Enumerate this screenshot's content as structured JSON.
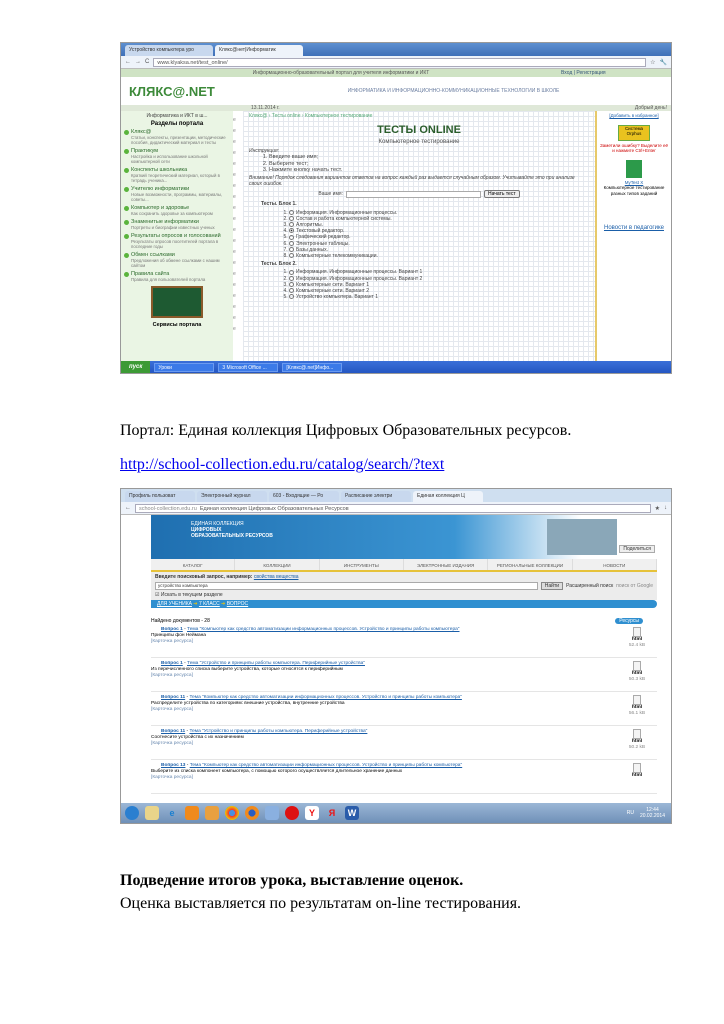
{
  "shot1": {
    "tabs": [
      "Устройство компьютера уро",
      "Клякс@нет|Информатик"
    ],
    "url": "www.klyaksa.net/test_online/",
    "top_banner": "Информационно-образовательный портал для учителя информатики и ИКТ",
    "login": "Вход | Регистрация",
    "logo": "КЛЯКС@.NET",
    "subtitle": "ИНФОРМАТИКА И ИНФОРМАЦИОННО-КОММУНИКАЦИОННЫЕ ТЕХНОЛОГИИ В ШКОЛЕ",
    "date": "13.11.2014 г.",
    "greeting": "Добрый день!",
    "side_header": "Информатика и ИКТ в ш...",
    "sections_title": "Разделы портала",
    "sections": [
      {
        "title": "Клякс@",
        "desc": "Статьи, конспекты, презентации, методические пособия, дидактический материал и тесты"
      },
      {
        "title": "Практикум",
        "desc": "Настройка и использование школьной компьютерной сети"
      },
      {
        "title": "Конспекты школьника",
        "desc": "Краткий теоретический материал, который в тетрадь ученика..."
      },
      {
        "title": "Учителю информатики",
        "desc": "Новые возможности, программы, материалы, советы..."
      },
      {
        "title": "Компьютер и здоровье",
        "desc": "Как сохранить здоровье за компьютером"
      },
      {
        "title": "Знаменитые информатики",
        "desc": "Портреты и биографии известных ученых"
      },
      {
        "title": "Результаты опросов и голосований",
        "desc": "Результаты опросов посетителей портала в последние годы"
      },
      {
        "title": "Обмен ссылками",
        "desc": "Предложения об обмене ссылками с нашим сайтом"
      },
      {
        "title": "Правила сайта",
        "desc": "Правила для пользователей портала"
      }
    ],
    "services": "Сервисы портала",
    "breadcrumb": "Клякс@ › Тесты online › Компьютерное тестирование",
    "heading": "ТЕСТЫ ONLINE",
    "subheading": "Компьютерное тестирование",
    "instr_title": "Инструкция:",
    "instructions": [
      "Введите ваше имя;",
      "Выберите тест;",
      "Нажмите кнопку начать тест."
    ],
    "warning": "Внимание! Порядок следования вариантов ответов на вопрос каждый раз выдается случайным образом. Учитывайте это при анализе своих ошибок.",
    "name_label": "Ваше имя:",
    "start_button": "Начать тест",
    "block1_title": "Тесты. Блок 1.",
    "block1": [
      "Информация. Информационные процессы.",
      "Состав и работа компьютерной системы.",
      "Алгоритмы.",
      "Текстовый редактор.",
      "Графический редактор.",
      "Электронные таблицы.",
      "Базы данных.",
      "Компьютерные телекоммуникации."
    ],
    "block2_title": "Тесты. Блок 2.",
    "block2": [
      "Информация. Информационные процессы. Вариант 1",
      "Информация. Информационные процессы. Вариант 2",
      "Компьютерные сети. Вариант 1",
      "Компьютерные сети. Вариант 2",
      "Устройство компьютера. Вариант 1"
    ],
    "right_add": "[Добавить в избранное]",
    "right_orphus": "Система Orphus",
    "right_text": "Заметили ошибку? Выделите её и нажмите Ctrl+Enter",
    "right_mytest": "MyTest X",
    "right_mytest_desc": "Компьютерное тестирование разных типов заданий",
    "right_link": "Новости в педагогике",
    "taskbar": {
      "start": "пуск",
      "tasks": [
        "Уроки",
        "3 Microsoft Office ...",
        "[Клякс@.net]Инфо..."
      ]
    }
  },
  "caption1": "Портал: Единая коллекция Цифровых Образовательных ресурсов.",
  "link": "http://school-collection.edu.ru/catalog/search/?text",
  "shot2": {
    "tabs": [
      "Профиль пользоват",
      "Электронный журнал",
      "603 - Входящие — Ро",
      "Расписание электри",
      "Единая коллекция Ц"
    ],
    "url": "school-collection.edu.ru",
    "page_title": "Единая коллекция Цифровых Образовательных Ресурсов",
    "logo_lines": [
      "ЕДИНАЯ КОЛЛЕКЦИЯ",
      "ЦИФРОВЫХ",
      "ОБРАЗОВАТЕЛЬНЫХ РЕСУРСОВ"
    ],
    "share": "Поделиться",
    "nav": [
      "КАТАЛОГ",
      "КОЛЛЕКЦИИ",
      "ИНСТРУМЕНТЫ",
      "ЭЛЕКТРОННЫЕ ИЗДАНИЯ",
      "РЕГИОНАЛЬНЫЕ КОЛЛЕКЦИИ",
      "НОВОСТИ"
    ],
    "search_label": "Введите поисковый запрос, например:",
    "search_example": "свойства вещества",
    "search_value": "устройство компьютера",
    "search_button": "Найти",
    "advanced": "Расширенный поиск",
    "google": "поиск от Google",
    "checkbox": "Искать в текущем разделе",
    "crumbs": [
      "ДЛЯ УЧЕНИКА",
      "7 КЛАСС",
      "ВОПРОС"
    ],
    "found": "Найдено документов - 28",
    "sort": "Ресурсы",
    "results": [
      {
        "q": "Вопрос 1",
        "topic": "Тема \"Компьютер как средство автоматизации информационных процессов. Устройство и принципы работы компьютера\"",
        "desc": "Принципы фон Неймана",
        "card": "[Карточка ресурса]",
        "type": "html",
        "size": "52.4 kB"
      },
      {
        "q": "Вопрос 1",
        "topic": "Тема \"Устройство и принципы работы компьютера. Периферийные устройства\"",
        "desc": "Из перечисленного списка выберите устройства, которые относятся к периферийным",
        "card": "[Карточка ресурса]",
        "type": "html",
        "size": "50.3 kB"
      },
      {
        "q": "Вопрос 11",
        "topic": "Тема \"Компьютер как средство автоматизации информационных процессов. Устройство и принципы работы компьютера\"",
        "desc": "Распределите устройства по категориям: внешние устройства, внутренние устройства",
        "card": "[Карточка ресурса]",
        "type": "html",
        "size": "56.1 kB"
      },
      {
        "q": "Вопрос 11",
        "topic": "Тема \"Устройство и принципы работы компьютера. Периферийные устройства\"",
        "desc": "Соотнесите устройства с их назначением",
        "card": "[Карточка ресурса]",
        "type": "html",
        "size": "50.2 kB"
      },
      {
        "q": "Вопрос 13",
        "topic": "Тема \"Компьютер как средство автоматизации информационных процессов. Устройство и принципы работы компьютера\"",
        "desc": "Выберите из списка компонент компьютера, с помощью которого осуществляется длительное хранение данных",
        "card": "[Карточка ресурса]",
        "type": "html",
        "size": ""
      }
    ],
    "tray_lang": "RU",
    "time": "12:44",
    "date": "20.02.2014"
  },
  "heading": "Подведение итогов урока, выставление оценок.",
  "body_text": "Оценка выставляется по результатам on-line тестирования."
}
